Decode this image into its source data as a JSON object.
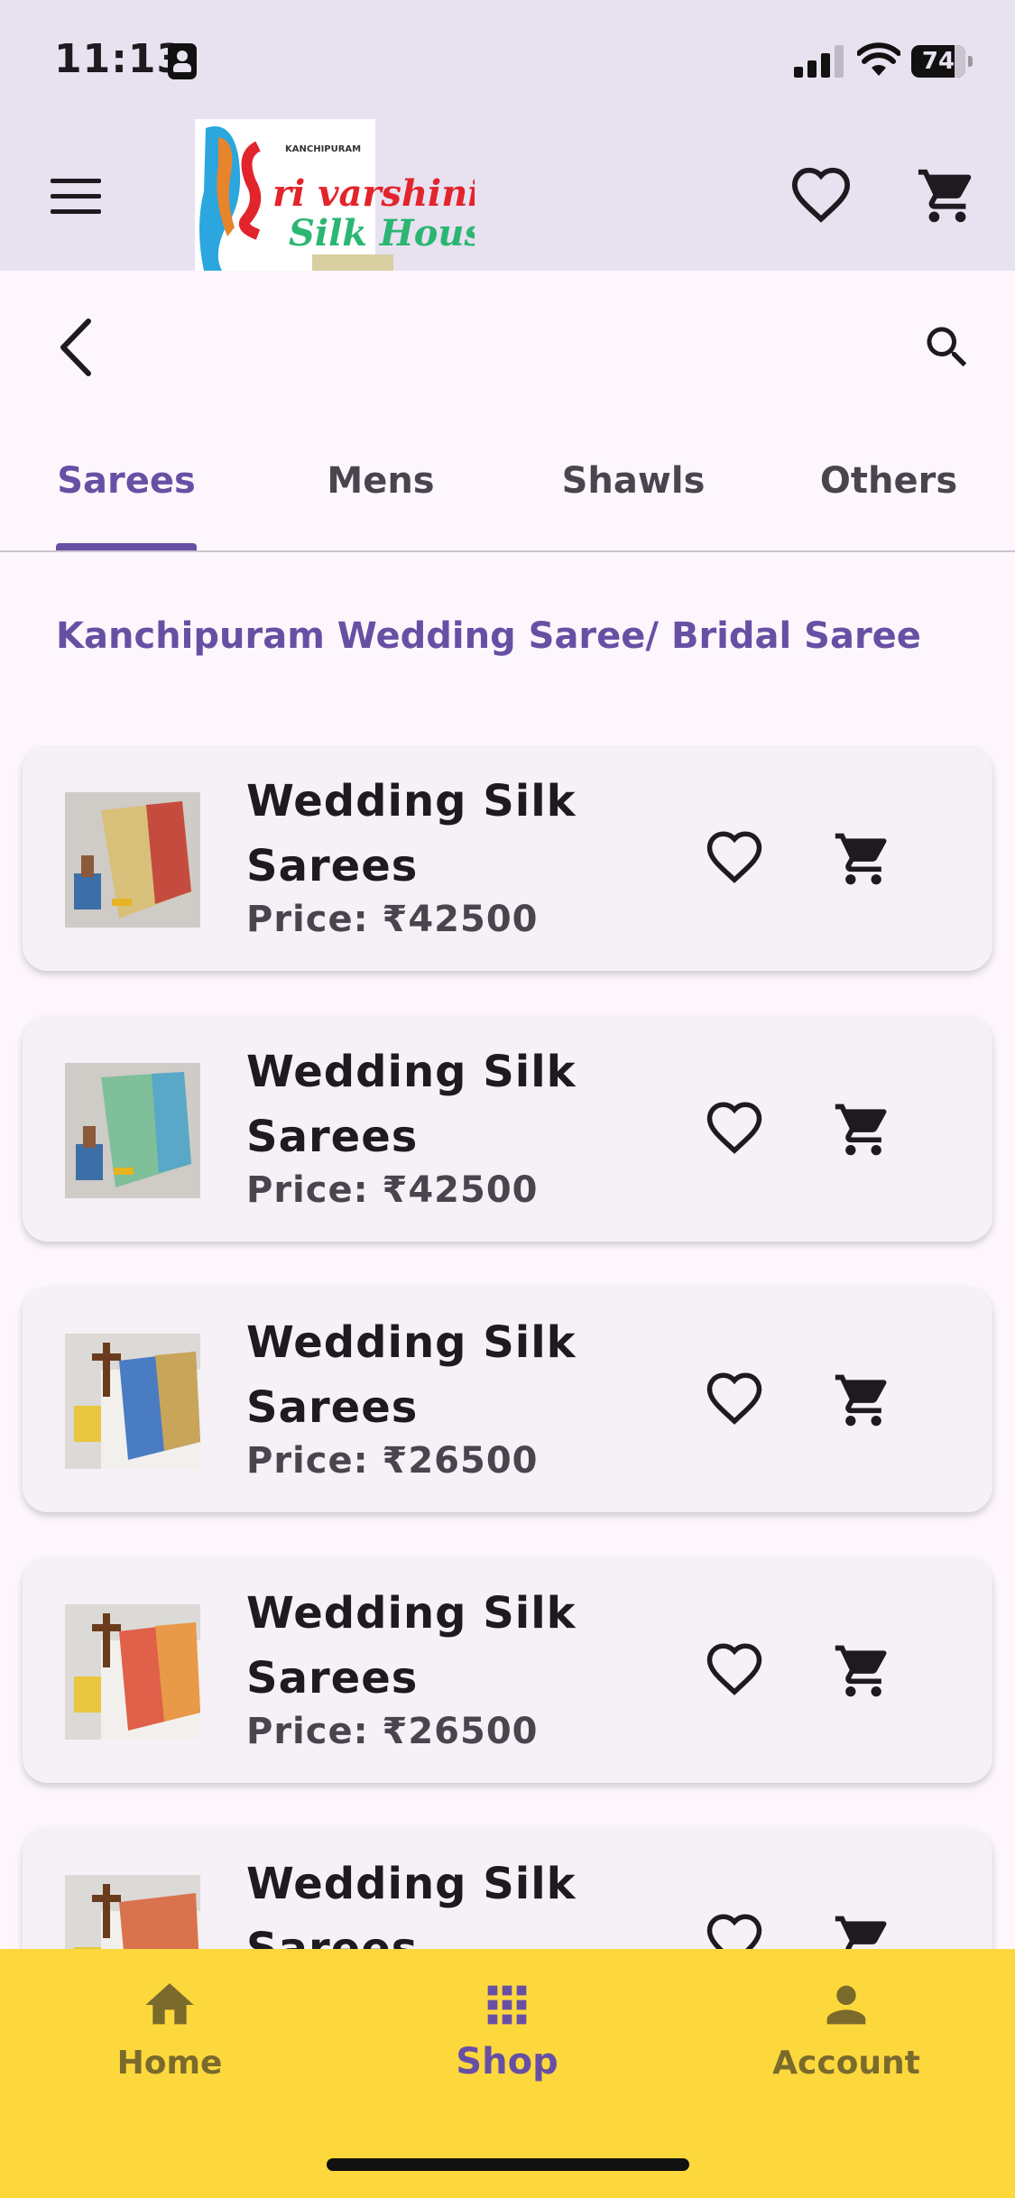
{
  "status_bar": {
    "time": "11:13",
    "battery": "74"
  },
  "app_bar": {
    "logo_alt": "Sri varshini Silk House"
  },
  "tabs": [
    {
      "label": "Sarees",
      "active": true
    },
    {
      "label": "Mens",
      "active": false
    },
    {
      "label": "Shawls",
      "active": false
    },
    {
      "label": "Others",
      "active": false
    }
  ],
  "section_title": "Kanchipuram Wedding Saree/ Bridal Saree",
  "products": [
    {
      "name": "Wedding Silk Sarees",
      "price": "Price: ₹42500"
    },
    {
      "name": "Wedding Silk Sarees",
      "price": "Price: ₹42500"
    },
    {
      "name": "Wedding Silk Sarees",
      "price": "Price: ₹26500"
    },
    {
      "name": "Wedding Silk Sarees",
      "price": "Price: ₹26500"
    },
    {
      "name": "Wedding Silk Sarees",
      "price": ""
    }
  ],
  "bottom_nav": [
    {
      "label": "Home",
      "icon": "home-icon",
      "active": false
    },
    {
      "label": "Shop",
      "icon": "grid-icon",
      "active": true
    },
    {
      "label": "Account",
      "icon": "person-icon",
      "active": false
    }
  ],
  "colors": {
    "accent": "#6750a4",
    "app_bar": "#e8e1f0",
    "bottom_nav": "#fdd83d",
    "card": "#f5f1f7"
  }
}
